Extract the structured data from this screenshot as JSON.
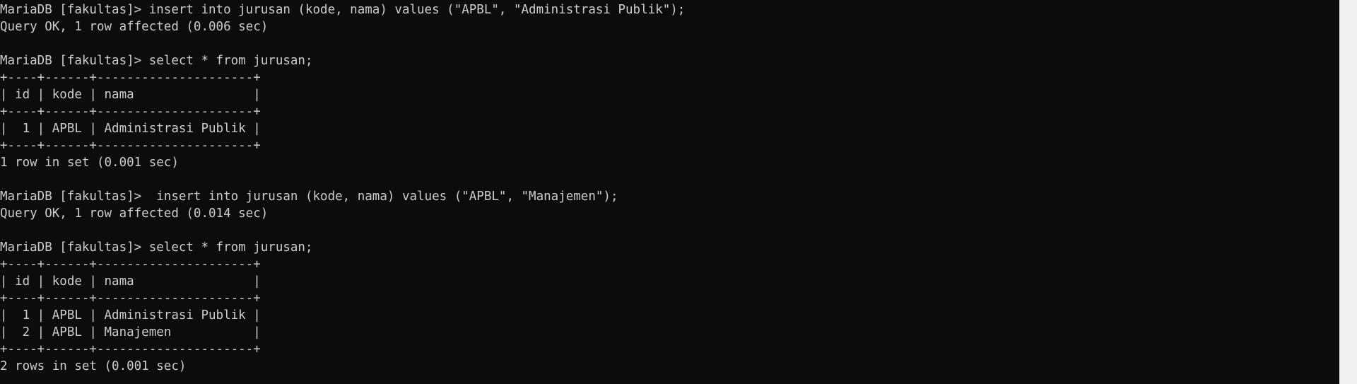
{
  "terminal": {
    "lines": [
      "MariaDB [fakultas]> insert into jurusan (kode, nama) values (\"APBL\", \"Administrasi Publik\");",
      "Query OK, 1 row affected (0.006 sec)",
      "",
      "MariaDB [fakultas]> select * from jurusan;",
      "+----+------+---------------------+",
      "| id | kode | nama                |",
      "+----+------+---------------------+",
      "|  1 | APBL | Administrasi Publik |",
      "+----+------+---------------------+",
      "1 row in set (0.001 sec)",
      "",
      "MariaDB [fakultas]>  insert into jurusan (kode, nama) values (\"APBL\", \"Manajemen\");",
      "Query OK, 1 row affected (0.014 sec)",
      "",
      "MariaDB [fakultas]> select * from jurusan;",
      "+----+------+---------------------+",
      "| id | kode | nama                |",
      "+----+------+---------------------+",
      "|  1 | APBL | Administrasi Publik |",
      "|  2 | APBL | Manajemen           |",
      "+----+------+---------------------+",
      "2 rows in set (0.001 sec)"
    ]
  },
  "colors": {
    "background": "#0c0c0c",
    "text": "#cccccc",
    "scrollbar_track": "#f0f0f0"
  }
}
